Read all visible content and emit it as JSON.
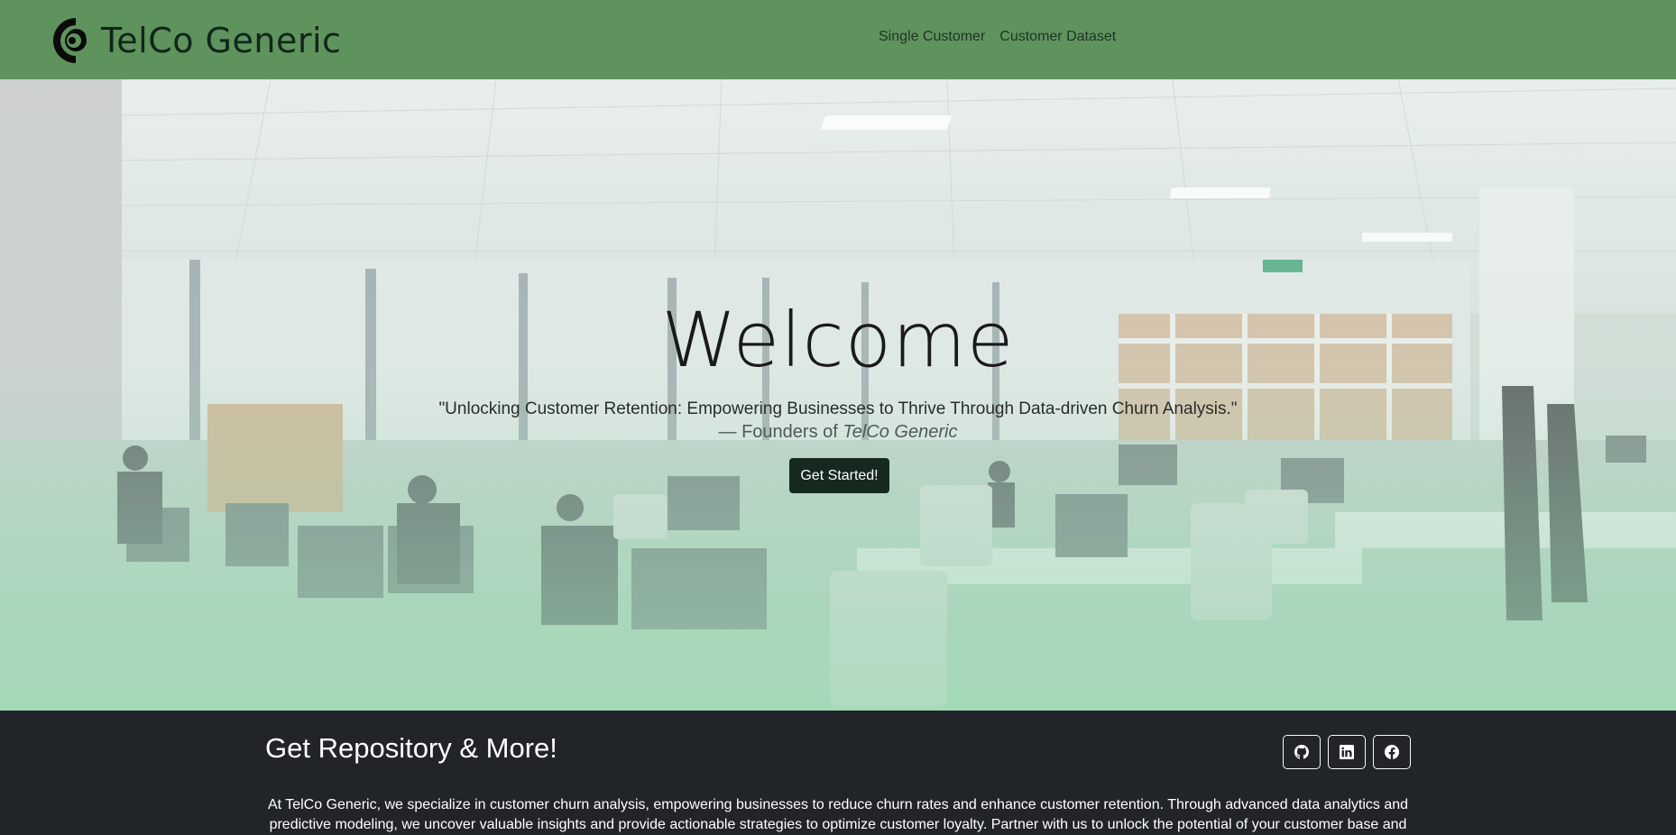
{
  "navbar": {
    "brand_name": "TelCo Generic",
    "logo_icon": "telco-logo-icon",
    "links": [
      {
        "label": "Single Customer"
      },
      {
        "label": "Customer Dataset"
      }
    ],
    "background_color": "#5f935d"
  },
  "hero": {
    "title": "Welcome",
    "quote": "\"Unlocking Customer Retention: Empowering Businesses to Thrive Through Data-driven Churn Analysis.\"",
    "attribution_prefix": "— Founders of ",
    "attribution_company": "TelCo Generic",
    "cta_label": "Get Started!",
    "cta_color": "#15291f"
  },
  "footer": {
    "title": "Get Repository & More!",
    "social": [
      {
        "icon": "github-icon"
      },
      {
        "icon": "linkedin-icon"
      },
      {
        "icon": "facebook-icon"
      }
    ],
    "text": "At TelCo Generic, we specialize in customer churn analysis, empowering businesses to reduce churn rates and enhance customer retention. Through advanced data analytics and predictive modeling, we uncover valuable insights and provide actionable strategies to optimize customer loyalty. Partner with us to unlock the potential of your customer base and",
    "background_color": "#212529"
  }
}
